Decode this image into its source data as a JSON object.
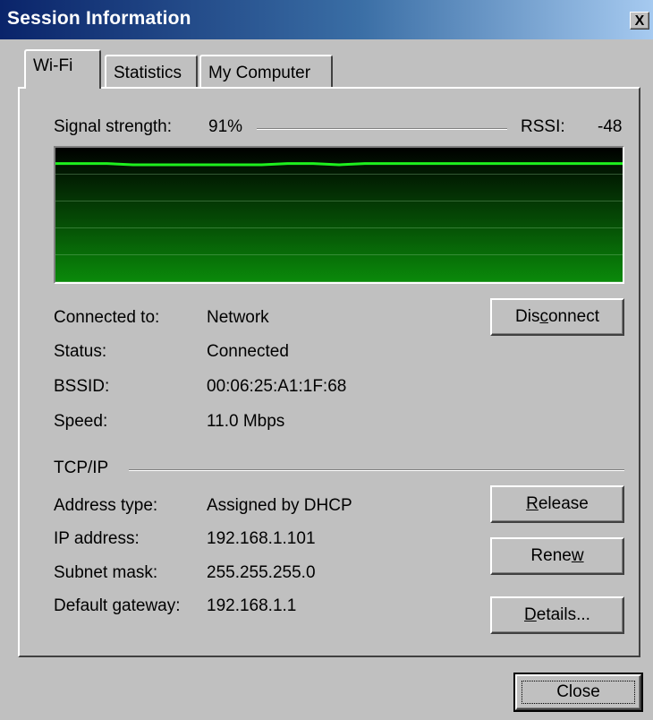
{
  "window": {
    "title": "Session Information",
    "close_glyph": "X"
  },
  "tabs": [
    {
      "label": "Wi-Fi",
      "active": true
    },
    {
      "label": "Statistics",
      "active": false
    },
    {
      "label": "My Computer",
      "active": false
    }
  ],
  "signal": {
    "label": "Signal strength:",
    "value": "91%",
    "rssi_label": "RSSI:",
    "rssi_value": "-48"
  },
  "signal_history": [
    92,
    92,
    92,
    91,
    91,
    91,
    91,
    91,
    91,
    92,
    92,
    91,
    92,
    92,
    92,
    92,
    92,
    92,
    92,
    92,
    92,
    92,
    92
  ],
  "connection": {
    "rows": [
      {
        "label": "Connected to:",
        "value": "Network"
      },
      {
        "label": "Status:",
        "value": "Connected"
      },
      {
        "label": "BSSID:",
        "value": "00:06:25:A1:1F:68"
      },
      {
        "label": "Speed:",
        "value": "11.0 Mbps"
      }
    ],
    "disconnect_button": {
      "pre": "Dis",
      "mnemonic": "c",
      "post": "onnect"
    }
  },
  "tcpip": {
    "section_label": "TCP/IP",
    "rows": [
      {
        "label": "Address type:",
        "value": "Assigned by DHCP"
      },
      {
        "label": "IP address:",
        "value": "192.168.1.101"
      },
      {
        "label": "Subnet mask:",
        "value": "255.255.255.0"
      },
      {
        "label": "Default gateway:",
        "value": "192.168.1.1"
      }
    ],
    "release_button": {
      "pre": "",
      "mnemonic": "R",
      "post": "elease"
    },
    "renew_button": {
      "pre": "Rene",
      "mnemonic": "w",
      "post": ""
    },
    "details_button": {
      "pre": "",
      "mnemonic": "D",
      "post": "etails..."
    }
  },
  "footer": {
    "close_label": "Close"
  },
  "colors": {
    "graph_line": "#1ef01e",
    "graph_bg_top": "#000000",
    "graph_bg_bottom": "#0a8a0a"
  }
}
